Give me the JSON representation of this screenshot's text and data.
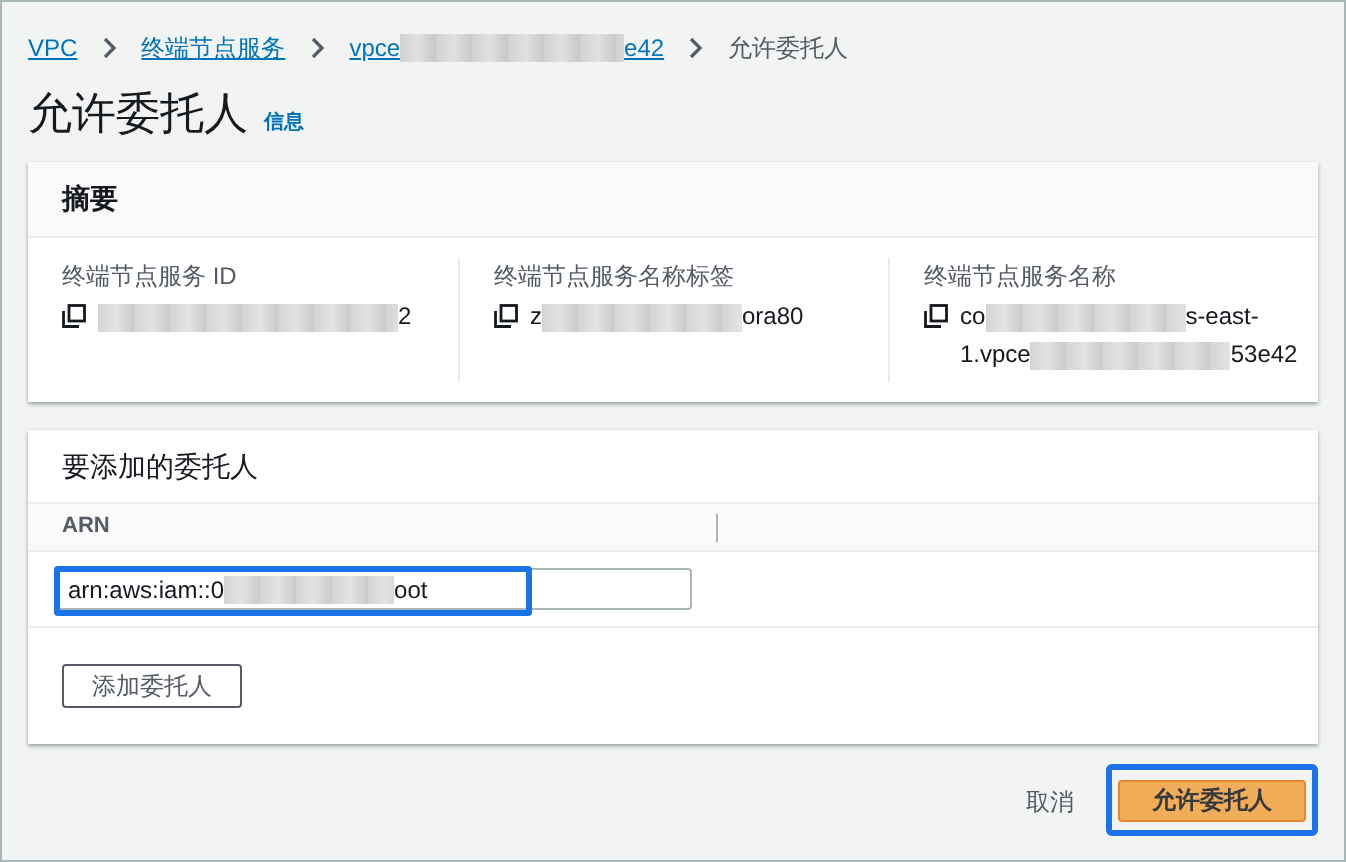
{
  "breadcrumb": [
    {
      "kind": "link",
      "segments": [
        {
          "kind": "text",
          "text": "VPC"
        }
      ]
    },
    {
      "kind": "link",
      "segments": [
        {
          "kind": "text",
          "text": "终端节点服务"
        }
      ]
    },
    {
      "kind": "link",
      "segments": [
        {
          "kind": "text",
          "text": "vpce"
        },
        {
          "kind": "redacted"
        },
        {
          "kind": "text",
          "text": "e42"
        }
      ]
    },
    {
      "kind": "current",
      "segments": [
        {
          "kind": "text",
          "text": "允许委托人"
        }
      ]
    }
  ],
  "page_title": "允许委托人",
  "info_link": "信息",
  "summary": {
    "title": "摘要",
    "fields": [
      {
        "label": "终端节点服务 ID",
        "lines": [
          [
            {
              "kind": "redacted"
            },
            {
              "kind": "text",
              "text": "2"
            }
          ]
        ]
      },
      {
        "label": "终端节点服务名称标签",
        "lines": [
          [
            {
              "kind": "text",
              "text": "z"
            },
            {
              "kind": "redacted"
            },
            {
              "kind": "text",
              "text": "ora80"
            }
          ]
        ]
      },
      {
        "label": "终端节点服务名称",
        "lines": [
          [
            {
              "kind": "text",
              "text": "co"
            },
            {
              "kind": "redacted"
            },
            {
              "kind": "text",
              "text": "s-east-"
            }
          ],
          [
            {
              "kind": "text",
              "text": "1.vpce"
            },
            {
              "kind": "redacted"
            },
            {
              "kind": "text",
              "text": "53e42"
            }
          ]
        ]
      }
    ]
  },
  "principals": {
    "title": "要添加的委托人",
    "columns": [
      "ARN"
    ],
    "rows": [
      {
        "arn": [
          {
            "kind": "text",
            "text": "arn:aws:iam::0"
          },
          {
            "kind": "redacted"
          },
          {
            "kind": "text",
            "text": "oot"
          }
        ],
        "highlighted": true
      }
    ],
    "add_button": "添加委托人"
  },
  "footer": {
    "cancel": "取消",
    "submit": "允许委托人",
    "submit_highlighted": true
  }
}
